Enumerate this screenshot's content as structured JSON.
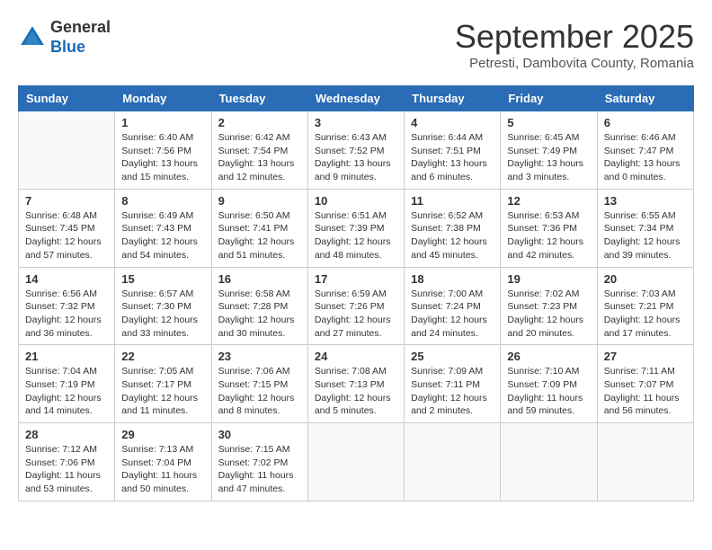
{
  "logo": {
    "general": "General",
    "blue": "Blue"
  },
  "title": "September 2025",
  "location": "Petresti, Dambovita County, Romania",
  "weekdays": [
    "Sunday",
    "Monday",
    "Tuesday",
    "Wednesday",
    "Thursday",
    "Friday",
    "Saturday"
  ],
  "weeks": [
    [
      {
        "day": "",
        "info": ""
      },
      {
        "day": "1",
        "info": "Sunrise: 6:40 AM\nSunset: 7:56 PM\nDaylight: 13 hours\nand 15 minutes."
      },
      {
        "day": "2",
        "info": "Sunrise: 6:42 AM\nSunset: 7:54 PM\nDaylight: 13 hours\nand 12 minutes."
      },
      {
        "day": "3",
        "info": "Sunrise: 6:43 AM\nSunset: 7:52 PM\nDaylight: 13 hours\nand 9 minutes."
      },
      {
        "day": "4",
        "info": "Sunrise: 6:44 AM\nSunset: 7:51 PM\nDaylight: 13 hours\nand 6 minutes."
      },
      {
        "day": "5",
        "info": "Sunrise: 6:45 AM\nSunset: 7:49 PM\nDaylight: 13 hours\nand 3 minutes."
      },
      {
        "day": "6",
        "info": "Sunrise: 6:46 AM\nSunset: 7:47 PM\nDaylight: 13 hours\nand 0 minutes."
      }
    ],
    [
      {
        "day": "7",
        "info": "Sunrise: 6:48 AM\nSunset: 7:45 PM\nDaylight: 12 hours\nand 57 minutes."
      },
      {
        "day": "8",
        "info": "Sunrise: 6:49 AM\nSunset: 7:43 PM\nDaylight: 12 hours\nand 54 minutes."
      },
      {
        "day": "9",
        "info": "Sunrise: 6:50 AM\nSunset: 7:41 PM\nDaylight: 12 hours\nand 51 minutes."
      },
      {
        "day": "10",
        "info": "Sunrise: 6:51 AM\nSunset: 7:39 PM\nDaylight: 12 hours\nand 48 minutes."
      },
      {
        "day": "11",
        "info": "Sunrise: 6:52 AM\nSunset: 7:38 PM\nDaylight: 12 hours\nand 45 minutes."
      },
      {
        "day": "12",
        "info": "Sunrise: 6:53 AM\nSunset: 7:36 PM\nDaylight: 12 hours\nand 42 minutes."
      },
      {
        "day": "13",
        "info": "Sunrise: 6:55 AM\nSunset: 7:34 PM\nDaylight: 12 hours\nand 39 minutes."
      }
    ],
    [
      {
        "day": "14",
        "info": "Sunrise: 6:56 AM\nSunset: 7:32 PM\nDaylight: 12 hours\nand 36 minutes."
      },
      {
        "day": "15",
        "info": "Sunrise: 6:57 AM\nSunset: 7:30 PM\nDaylight: 12 hours\nand 33 minutes."
      },
      {
        "day": "16",
        "info": "Sunrise: 6:58 AM\nSunset: 7:28 PM\nDaylight: 12 hours\nand 30 minutes."
      },
      {
        "day": "17",
        "info": "Sunrise: 6:59 AM\nSunset: 7:26 PM\nDaylight: 12 hours\nand 27 minutes."
      },
      {
        "day": "18",
        "info": "Sunrise: 7:00 AM\nSunset: 7:24 PM\nDaylight: 12 hours\nand 24 minutes."
      },
      {
        "day": "19",
        "info": "Sunrise: 7:02 AM\nSunset: 7:23 PM\nDaylight: 12 hours\nand 20 minutes."
      },
      {
        "day": "20",
        "info": "Sunrise: 7:03 AM\nSunset: 7:21 PM\nDaylight: 12 hours\nand 17 minutes."
      }
    ],
    [
      {
        "day": "21",
        "info": "Sunrise: 7:04 AM\nSunset: 7:19 PM\nDaylight: 12 hours\nand 14 minutes."
      },
      {
        "day": "22",
        "info": "Sunrise: 7:05 AM\nSunset: 7:17 PM\nDaylight: 12 hours\nand 11 minutes."
      },
      {
        "day": "23",
        "info": "Sunrise: 7:06 AM\nSunset: 7:15 PM\nDaylight: 12 hours\nand 8 minutes."
      },
      {
        "day": "24",
        "info": "Sunrise: 7:08 AM\nSunset: 7:13 PM\nDaylight: 12 hours\nand 5 minutes."
      },
      {
        "day": "25",
        "info": "Sunrise: 7:09 AM\nSunset: 7:11 PM\nDaylight: 12 hours\nand 2 minutes."
      },
      {
        "day": "26",
        "info": "Sunrise: 7:10 AM\nSunset: 7:09 PM\nDaylight: 11 hours\nand 59 minutes."
      },
      {
        "day": "27",
        "info": "Sunrise: 7:11 AM\nSunset: 7:07 PM\nDaylight: 11 hours\nand 56 minutes."
      }
    ],
    [
      {
        "day": "28",
        "info": "Sunrise: 7:12 AM\nSunset: 7:06 PM\nDaylight: 11 hours\nand 53 minutes."
      },
      {
        "day": "29",
        "info": "Sunrise: 7:13 AM\nSunset: 7:04 PM\nDaylight: 11 hours\nand 50 minutes."
      },
      {
        "day": "30",
        "info": "Sunrise: 7:15 AM\nSunset: 7:02 PM\nDaylight: 11 hours\nand 47 minutes."
      },
      {
        "day": "",
        "info": ""
      },
      {
        "day": "",
        "info": ""
      },
      {
        "day": "",
        "info": ""
      },
      {
        "day": "",
        "info": ""
      }
    ]
  ]
}
